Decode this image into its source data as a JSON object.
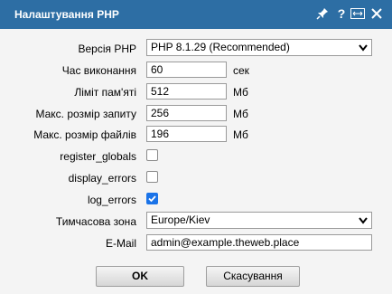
{
  "window": {
    "title": "Налаштування PHP",
    "buttons": [
      "pin-icon",
      "help-icon",
      "maximize-icon",
      "close-icon"
    ],
    "help_glyph": "?",
    "colors": {
      "titlebar": "#2d6ea4",
      "checkbox_checked": "#1a73e8"
    }
  },
  "form": {
    "php_version": {
      "label": "Версія PHP",
      "value": "PHP 8.1.29 (Recommended)"
    },
    "exec_time": {
      "label": "Час виконання",
      "value": "60",
      "unit": "сек"
    },
    "memory_limit": {
      "label": "Ліміт пам'яті",
      "value": "512",
      "unit": "Мб"
    },
    "max_post": {
      "label": "Макс. розмір запиту",
      "value": "256",
      "unit": "Мб"
    },
    "max_upload": {
      "label": "Макс. розмір файлів",
      "value": "196",
      "unit": "Мб"
    },
    "register_globals": {
      "label": "register_globals",
      "checked": false
    },
    "display_errors": {
      "label": "display_errors",
      "checked": false
    },
    "log_errors": {
      "label": "log_errors",
      "checked": true
    },
    "timezone": {
      "label": "Тимчасова зона",
      "value": "Europe/Kiev"
    },
    "email": {
      "label": "E-Mail",
      "value": "admin@example.theweb.place"
    }
  },
  "actions": {
    "ok_label": "OK",
    "cancel_label": "Скасування"
  }
}
